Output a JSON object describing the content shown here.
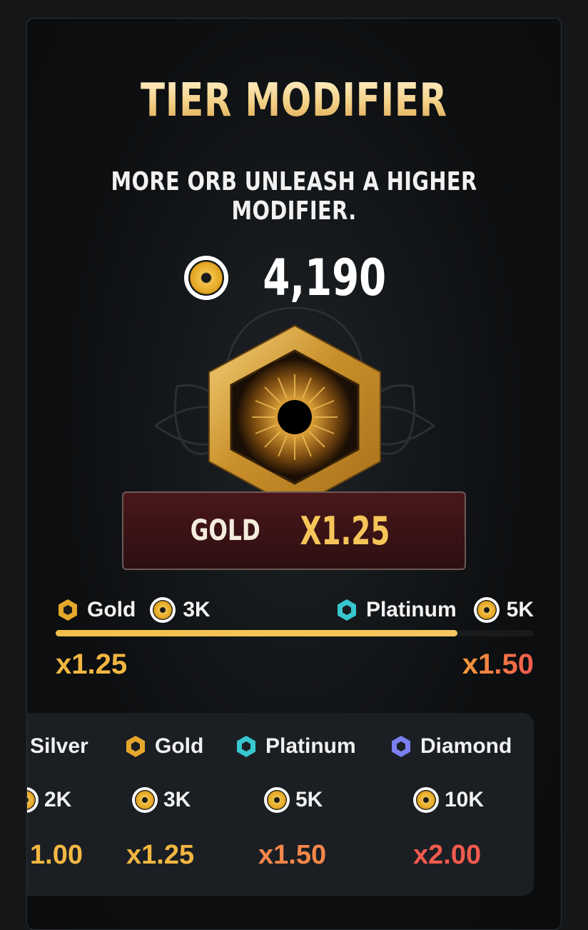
{
  "header": {
    "title": "TIER MODIFIER",
    "subtitle": "MORE ORB UNLEASH A HIGHER MODIFIER."
  },
  "balance": {
    "amount": "4,190",
    "icon": "orb-coin-icon"
  },
  "current_tier": {
    "name": "GOLD",
    "multiplier": "X1.25"
  },
  "progress": {
    "from": {
      "tier": "Gold",
      "cost": "3K",
      "multiplier": "x1.25"
    },
    "to": {
      "tier": "Platinum",
      "cost": "5K",
      "multiplier": "x1.50"
    },
    "fraction": 0.84
  },
  "tiers": [
    {
      "name": "Silver",
      "cost": "2K",
      "multiplier": "1.00",
      "hex_color": "#c9ced6"
    },
    {
      "name": "Gold",
      "cost": "3K",
      "multiplier": "x1.25",
      "hex_color": "#e5a82c"
    },
    {
      "name": "Platinum",
      "cost": "5K",
      "multiplier": "x1.50",
      "hex_color": "#38c6cf"
    },
    {
      "name": "Diamond",
      "cost": "10K",
      "multiplier": "x2.00",
      "hex_color": "#7b7ff0"
    }
  ],
  "colors": {
    "gold_accent": "#f6c55a",
    "platinum": "#38c6cf",
    "diamond": "#7b7ff0",
    "multiplier_high": "#f36a4a"
  }
}
